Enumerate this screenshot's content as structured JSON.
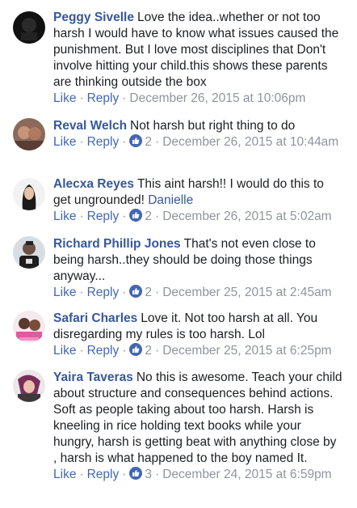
{
  "comments": [
    {
      "author": "Peggy Sivelle",
      "text": "Love the idea..whether or not too harsh I would have to know what issues caused the punishment. But I love most disciplines that Don't involve hitting your child.this shows these parents are thinking outside the box",
      "like": "Like",
      "reply": "Reply",
      "likes": "",
      "date": "December 26, 2015 at 10:06pm"
    },
    {
      "author": "Reval Welch",
      "text": "Not harsh but right thing to do",
      "like": "Like",
      "reply": "Reply",
      "likes": "2",
      "date": "December 26, 2015 at 10:44am"
    },
    {
      "author": "Alecxa Reyes",
      "text": "This aint harsh!! I would do this to get ungrounded!",
      "mention": "Danielle",
      "like": "Like",
      "reply": "Reply",
      "likes": "2",
      "date": "December 26, 2015 at 5:02am"
    },
    {
      "author": "Richard Phillip Jones",
      "text": "That's not even close to being harsh..they should be doing those things anyway...",
      "like": "Like",
      "reply": "Reply",
      "likes": "2",
      "date": "December 25, 2015 at 2:45am"
    },
    {
      "author": "Safari Charles",
      "text": "Love it. Not too harsh at all. You disregarding my rules is too harsh. Lol",
      "like": "Like",
      "reply": "Reply",
      "likes": "2",
      "date": "December 25, 2015 at 6:25pm"
    },
    {
      "author": "Yaira Taveras",
      "text": "No this is awesome. Teach your child about structure and consequences behind actions. Soft as people taking about too harsh. Harsh is kneeling in rice holding text books while your hungry, harsh is getting beat with anything close by , harsh is what happened to the boy named It.",
      "like": "Like",
      "reply": "Reply",
      "likes": "3",
      "date": "December 24, 2015 at 6:59pm"
    }
  ],
  "colors": {
    "link": "#365899",
    "action": "#4267b2",
    "meta": "#90949c",
    "text": "#1c1e21"
  }
}
